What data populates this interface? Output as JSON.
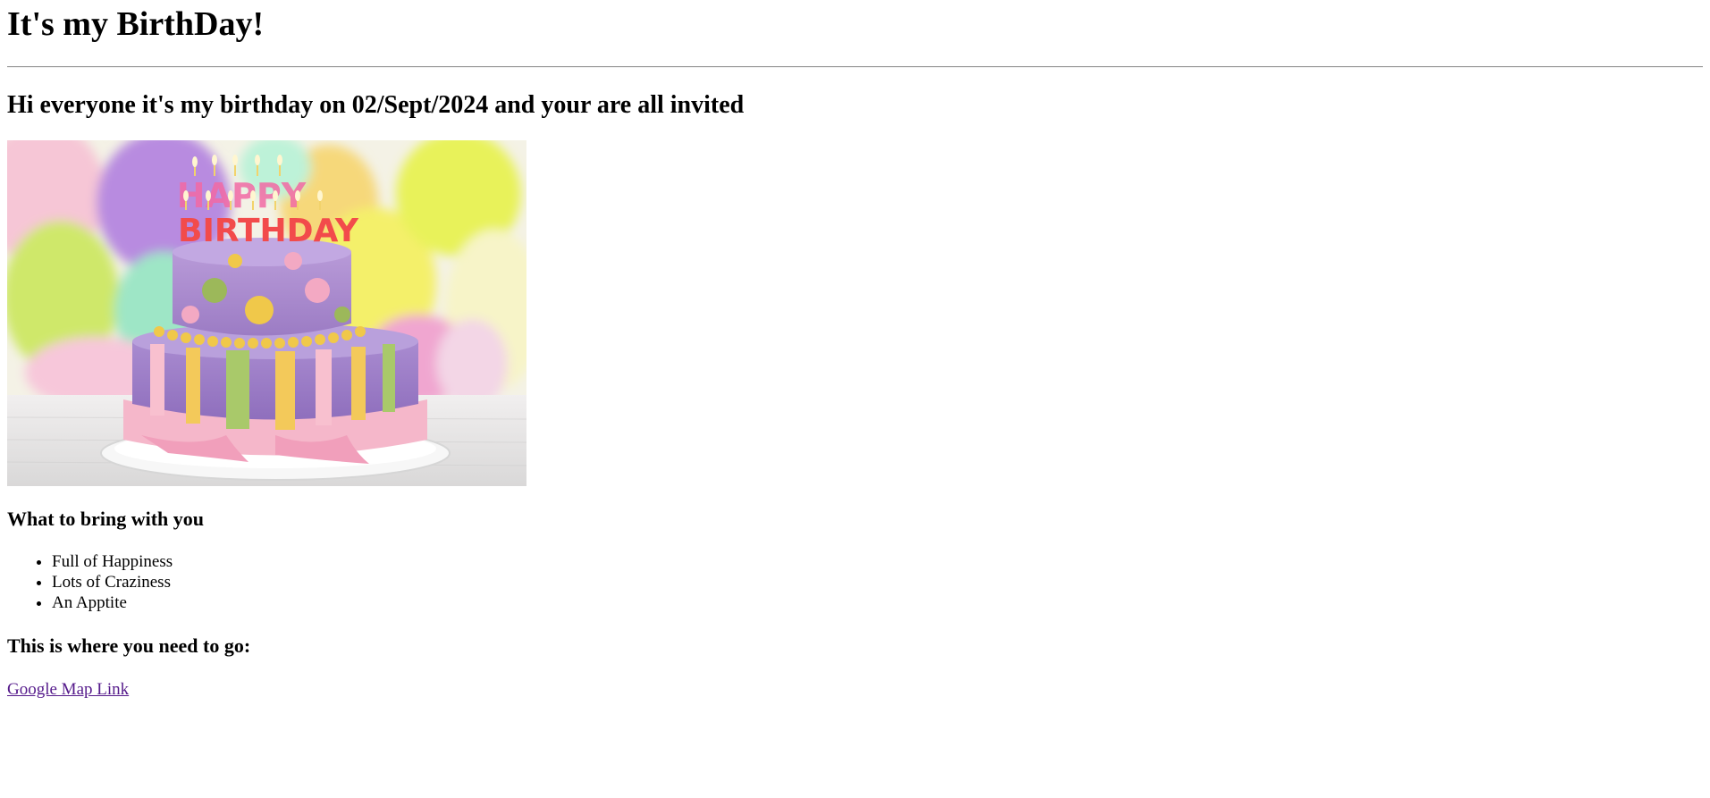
{
  "page": {
    "title": "It's my BirthDay!",
    "subtitle": "Hi everyone it's my birthday on 02/Sept/2024 and your are all invited",
    "image": {
      "candle_text_top": "HAPPY",
      "candle_text_bottom": "BIRTHDAY"
    },
    "bring_heading": "What to bring with you",
    "bring_items": [
      "Full of Happiness",
      "Lots of Craziness",
      "An Apptite"
    ],
    "where_heading": "This is where you need to go:",
    "map_link_label": "Google Map Link"
  },
  "colors": {
    "link_visited": "#551a8b",
    "divider": "#9a9a9a"
  }
}
